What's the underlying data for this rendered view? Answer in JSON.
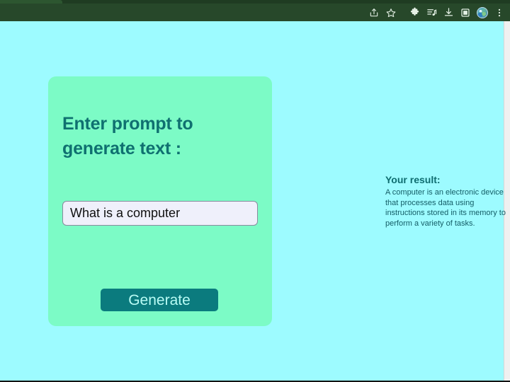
{
  "browser": {
    "toolbar_icons": [
      {
        "name": "share-icon",
        "label": "Share this page"
      },
      {
        "name": "bookmark-star-icon",
        "label": "Bookmark this tab"
      },
      {
        "name": "extensions-puzzle-icon",
        "label": "Extensions"
      },
      {
        "name": "reading-list-icon",
        "label": "Reading list"
      },
      {
        "name": "download-icon",
        "label": "Downloads"
      },
      {
        "name": "side-panel-icon",
        "label": "Side panel"
      },
      {
        "name": "profile-avatar-icon",
        "label": "Profile"
      },
      {
        "name": "three-dot-menu-icon",
        "label": "Customize and control"
      }
    ]
  },
  "card": {
    "heading_line1": "Enter prompt to",
    "heading_line2": "generate text :",
    "input_value": "What is a computer",
    "input_placeholder": "",
    "generate_label": "Generate"
  },
  "result": {
    "heading": "Your result:",
    "text": "A computer is an electronic device that processes data using instructions stored in its memory to perform a variety of tasks."
  },
  "colors": {
    "page_background": "#9dfbff",
    "card_background": "#7cfbc6",
    "heading_teal": "#0f7070",
    "button_teal": "#0b7b7e",
    "button_text": "#b8fbf4",
    "input_background": "#eff0fb",
    "chrome_green": "#27482a"
  }
}
